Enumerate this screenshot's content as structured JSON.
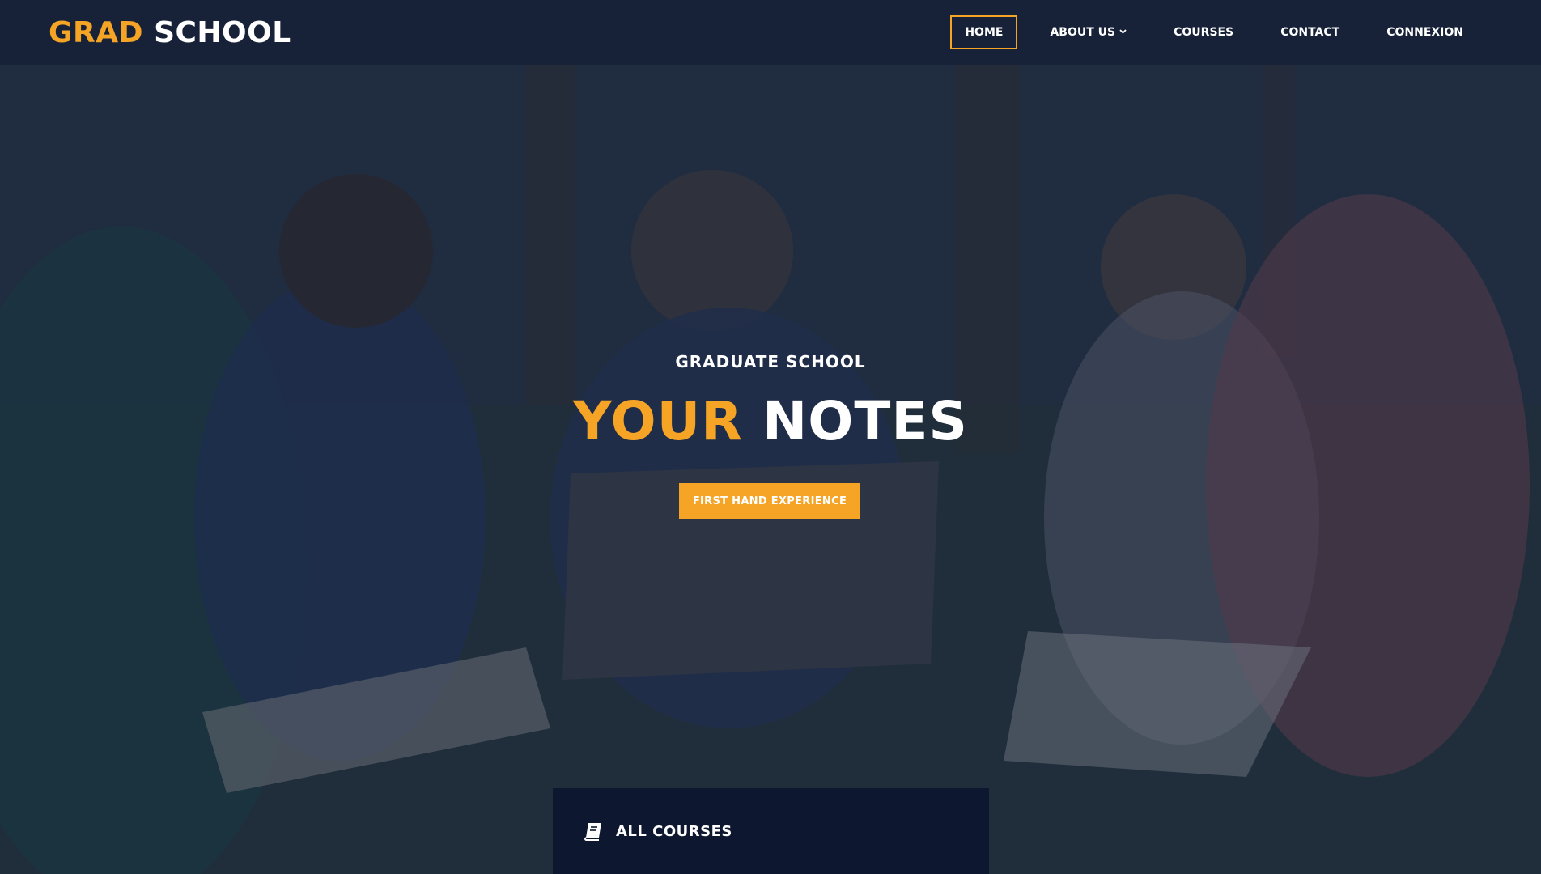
{
  "header": {
    "logo_accent": "GRAD",
    "logo_main": "SCHOOL",
    "nav": [
      {
        "label": "HOME",
        "active": true
      },
      {
        "label": "ABOUT US",
        "has_dropdown": true
      },
      {
        "label": "COURSES"
      },
      {
        "label": "CONTACT"
      },
      {
        "label": "CONNEXION"
      }
    ]
  },
  "hero": {
    "subtitle": "GRADUATE SCHOOL",
    "title_accent": "YOUR",
    "title_main": "NOTES",
    "cta_label": "FIRST HAND EXPERIENCE"
  },
  "courses_card": {
    "icon": "book-icon",
    "label": "ALL COURSES"
  },
  "colors": {
    "accent": "#f5a425",
    "header_bg": "#172238",
    "card_bg": "#0d1730",
    "text": "#ffffff"
  }
}
